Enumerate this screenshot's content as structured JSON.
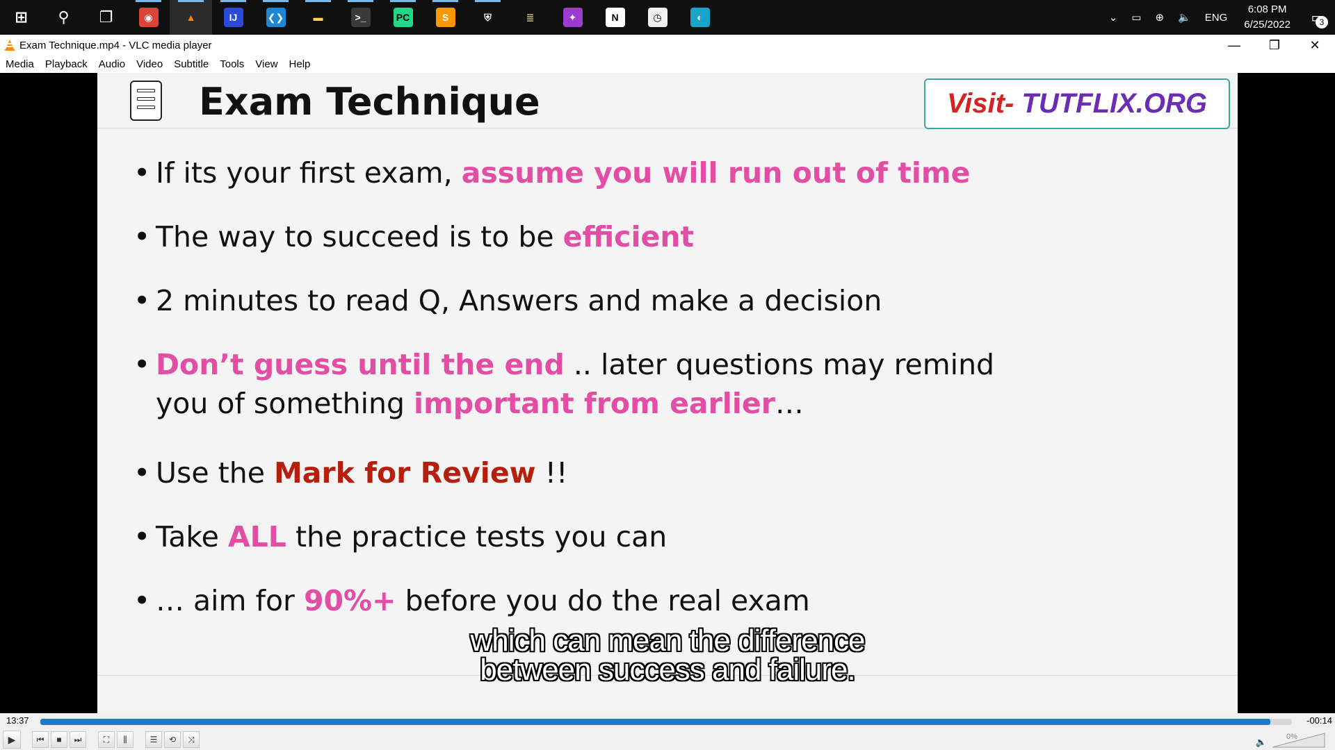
{
  "taskbar": {
    "apps": [
      {
        "name": "start-icon",
        "glyph": "⊞",
        "color": "#ffffff",
        "bg": ""
      },
      {
        "name": "search-icon",
        "glyph": "⚲",
        "color": "#ffffff",
        "bg": ""
      },
      {
        "name": "task-view-icon",
        "glyph": "❐",
        "color": "#ffffff",
        "bg": ""
      },
      {
        "name": "chrome-icon",
        "glyph": "◉",
        "color": "#ffffff",
        "bg": "#db4437"
      },
      {
        "name": "vlc-icon",
        "glyph": "▲",
        "color": "#ff8800",
        "bg": ""
      },
      {
        "name": "intellij-icon",
        "glyph": "IJ",
        "color": "#ffffff",
        "bg": "#2b4bd6"
      },
      {
        "name": "vscode-icon",
        "glyph": "❮❯",
        "color": "#ffffff",
        "bg": "#1f86d6"
      },
      {
        "name": "file-explorer-icon",
        "glyph": "▬",
        "color": "#ffd25b",
        "bg": ""
      },
      {
        "name": "terminal-icon",
        "glyph": ">_",
        "color": "#ffffff",
        "bg": "#3a3a3a"
      },
      {
        "name": "pycharm-icon",
        "glyph": "PC",
        "color": "#000000",
        "bg": "#21d789"
      },
      {
        "name": "sublime-text-icon",
        "glyph": "S",
        "color": "#ffffff",
        "bg": "#ff9800"
      },
      {
        "name": "security-shield-icon",
        "glyph": "⛨",
        "color": "#ffffff",
        "bg": ""
      },
      {
        "name": "books-icon",
        "glyph": "≣",
        "color": "#c9b27a",
        "bg": ""
      },
      {
        "name": "media-app-icon",
        "glyph": "✦",
        "color": "#ffffff",
        "bg": "#9b3bd0"
      },
      {
        "name": "notion-icon",
        "glyph": "N",
        "color": "#000000",
        "bg": "#ffffff"
      },
      {
        "name": "clock-app-icon",
        "glyph": "◷",
        "color": "#000000",
        "bg": "#f0f0f0"
      },
      {
        "name": "edge-icon",
        "glyph": "◐",
        "color": "#ffffff",
        "bg": "#1aa3c8"
      }
    ],
    "tray": {
      "chevron": "⌄",
      "battery": "▭",
      "network": "⊕",
      "volume": "🔈",
      "language": "ENG",
      "time": "6:08 PM",
      "date": "6/25/2022",
      "notification_count": "3"
    }
  },
  "window": {
    "title": "Exam Technique.mp4 - VLC media player",
    "minimize": "—",
    "restore": "❐",
    "close": "✕"
  },
  "menu": [
    "Media",
    "Playback",
    "Audio",
    "Video",
    "Subtitle",
    "Tools",
    "View",
    "Help"
  ],
  "slide": {
    "title": "Exam Technique",
    "promo_visit": "Visit-",
    "promo_site": "TUTFLIX.ORG",
    "bullets": [
      [
        {
          "t": "If its your first exam, ",
          "s": ""
        },
        {
          "t": "assume you will run out of time",
          "s": "pink"
        }
      ],
      [
        {
          "t": "The way to succeed is to be ",
          "s": ""
        },
        {
          "t": "efficient",
          "s": "pink"
        }
      ],
      [
        {
          "t": "2 minutes to read Q, Answers and make a decision",
          "s": ""
        }
      ],
      [
        {
          "t": "Don’t guess until the end",
          "s": "pink"
        },
        {
          "t": " .. later questions may remind you of something ",
          "s": ""
        },
        {
          "t": "important from earlier",
          "s": "pink"
        },
        {
          "t": "…",
          "s": ""
        }
      ],
      [
        {
          "t": "Use the ",
          "s": ""
        },
        {
          "t": "Mark for Review",
          "s": "red"
        },
        {
          "t": " !!",
          "s": ""
        }
      ],
      [
        {
          "t": "Take ",
          "s": ""
        },
        {
          "t": "ALL",
          "s": "pink"
        },
        {
          "t": " the practice tests you can",
          "s": ""
        }
      ],
      [
        {
          "t": "… aim for ",
          "s": ""
        },
        {
          "t": "90%+",
          "s": "pink"
        },
        {
          "t": " before you do the real exam",
          "s": ""
        }
      ]
    ]
  },
  "subtitle": {
    "line1": "which can mean the difference",
    "line2": "between success and failure."
  },
  "player": {
    "elapsed": "13:37",
    "remaining": "-00:14",
    "progress_percent": 98.3,
    "volume_label": "0%",
    "buttons": {
      "play": "▶",
      "previous": "⏮",
      "stop": "■",
      "next": "⏭",
      "fullscreen": "⛶",
      "extended_settings": "⫼",
      "playlist": "☰",
      "loop": "⟲",
      "shuffle": "⤨"
    }
  },
  "colors": {
    "accent_pink": "#e24ea4",
    "accent_red": "#b5200e",
    "seek_blue": "#1a78d6"
  }
}
